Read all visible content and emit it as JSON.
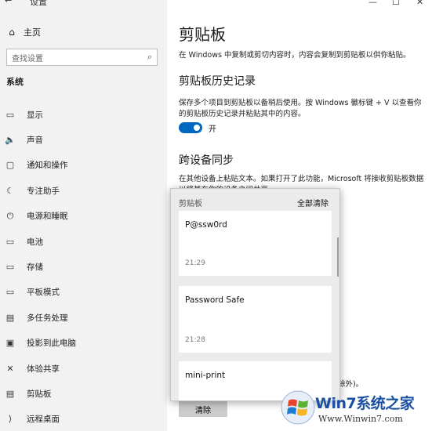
{
  "window": {
    "title": "设置",
    "back_glyph": "←",
    "min_glyph": "—",
    "max_glyph": "☐"
  },
  "sidebar": {
    "home_label": "主页",
    "search_placeholder": "查找设置",
    "section_title": "系统",
    "items": [
      {
        "label": "显示",
        "icon": "monitor-icon",
        "glyph": "▭"
      },
      {
        "label": "声音",
        "icon": "speaker-icon",
        "glyph": "🔈"
      },
      {
        "label": "通知和操作",
        "icon": "notification-icon",
        "glyph": "▢"
      },
      {
        "label": "专注助手",
        "icon": "moon-icon",
        "glyph": "☾"
      },
      {
        "label": "电源和睡眠",
        "icon": "power-icon",
        "glyph": "⏻"
      },
      {
        "label": "电池",
        "icon": "battery-icon",
        "glyph": "▭"
      },
      {
        "label": "存储",
        "icon": "storage-icon",
        "glyph": "▭"
      },
      {
        "label": "平板模式",
        "icon": "tablet-icon",
        "glyph": "▭"
      },
      {
        "label": "多任务处理",
        "icon": "multitask-icon",
        "glyph": "▤"
      },
      {
        "label": "投影到此电脑",
        "icon": "project-icon",
        "glyph": "▣"
      },
      {
        "label": "体验共享",
        "icon": "share-icon",
        "glyph": "✕"
      },
      {
        "label": "剪贴板",
        "icon": "clipboard-icon",
        "glyph": "▤"
      },
      {
        "label": "远程桌面",
        "icon": "remote-icon",
        "glyph": "⟩"
      }
    ]
  },
  "main": {
    "title": "剪贴板",
    "intro": "在 Windows 中复制或剪切内容时，内容会复制到剪贴板以供你粘贴。",
    "history_heading": "剪贴板历史记录",
    "history_desc": "保存多个项目到剪贴板以备稍后使用。按 Windows 徽标键 + V 以查看你的剪贴板历史记录并粘贴其中的内容。",
    "toggle_state": "开",
    "sync_heading": "跨设备同步",
    "sync_desc": "在其他设备上粘贴文本。如果打开了此功能，Microsoft 将接收剪贴板数据以将其在你的设备之间共享。",
    "partial_text": "除外)。",
    "clear_button": "清除"
  },
  "flyout": {
    "title": "剪贴板",
    "clear_all": "全部清除",
    "items": [
      {
        "text": "P@ssw0rd",
        "time": "21:29"
      },
      {
        "text": "Password Safe",
        "time": "21:28"
      },
      {
        "text": "mini-print",
        "time": ""
      }
    ]
  },
  "watermark": {
    "brand": "Win7系统之家",
    "url": "Www.Winwin7.com"
  },
  "colors": {
    "accent": "#0067c0",
    "sidebar_bg": "#f2f2f2",
    "flyout_bg": "#ebebeb"
  }
}
